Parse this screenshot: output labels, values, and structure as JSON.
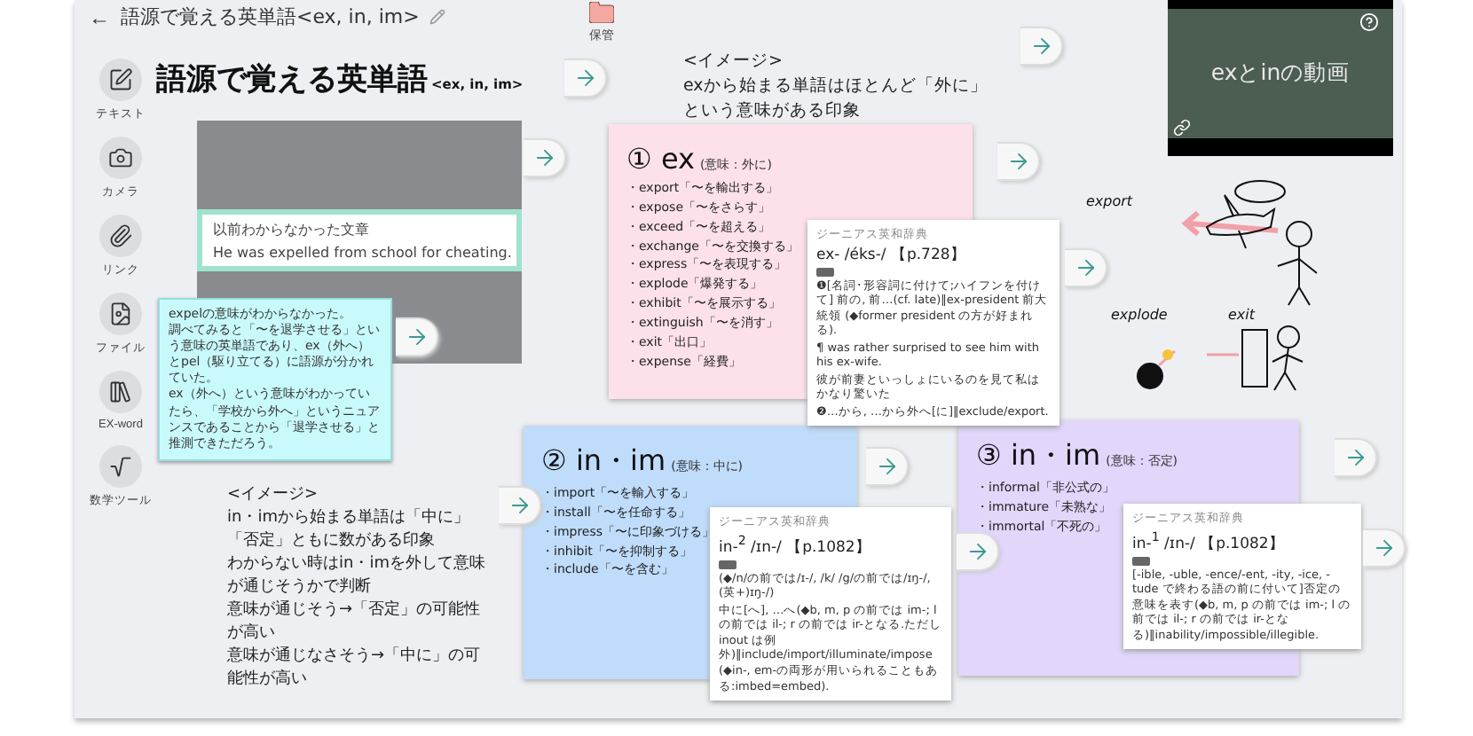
{
  "header": {
    "back": "←",
    "title": "語源で覚える英単語<ex, in, im>"
  },
  "storage": {
    "label": "保管"
  },
  "tools": [
    {
      "label": "テキスト",
      "kind": "text"
    },
    {
      "label": "カメラ",
      "kind": "camera"
    },
    {
      "label": "リンク",
      "kind": "link"
    },
    {
      "label": "ファイル",
      "kind": "file"
    },
    {
      "label": "EX-word",
      "kind": "book"
    },
    {
      "label": "数学ツール",
      "kind": "math"
    }
  ],
  "board": {
    "title": "語源で覚える英単語",
    "subtitle": "<ex, in, im>"
  },
  "photo_card": {
    "caption": "以前わからなかった文章",
    "sentence": "He was expelled from school for cheating."
  },
  "note": {
    "lines": [
      "expelの意味がわからなかった。",
      "調べてみると「〜を退学させる」という意味の英単語であり、ex（外へ）とpel（駆り立てる）に語源が分かれていた。",
      "ex（外へ）という意味がわかっていたら、「学校から外へ」というニュアンスであることから「退学させる」と推測できただろう。"
    ]
  },
  "image_notes": [
    {
      "lines": [
        "<イメージ>",
        "exから始まる単語はほとんど「外に」という意味がある印象"
      ]
    },
    {
      "lines": [
        "<イメージ>",
        "in・imから始まる単語は「中に」「否定」ともに数がある印象",
        "わからない時はin・imを外して意味が通じそうかで判断",
        "意味が通じそう→「否定」の可能性が高い",
        "意味が通じなさそう→「中に」の可能性が高い"
      ]
    }
  ],
  "word_cards": [
    {
      "number": "①",
      "prefix": "ex",
      "meaning": "(意味：外に)",
      "color": "#fde1ea",
      "items": [
        {
          "word": "・export",
          "gloss": "「〜を輸出する」"
        },
        {
          "word": "・expose",
          "gloss": "「〜をさらす」"
        },
        {
          "word": "・exceed",
          "gloss": "「〜を超える」"
        },
        {
          "word": "・exchange",
          "gloss": "「〜を交換する」"
        },
        {
          "word": "・express",
          "gloss": "「〜を表現する」"
        },
        {
          "word": "・explode",
          "gloss": "「爆発する」"
        },
        {
          "word": "・exhibit",
          "gloss": "「〜を展示する」"
        },
        {
          "word": "・extinguish",
          "gloss": "「〜を消す」"
        },
        {
          "word": "・exit",
          "gloss": "「出口」"
        },
        {
          "word": "・expense",
          "gloss": "「経費」"
        }
      ]
    },
    {
      "number": "②",
      "prefix": "in・im",
      "meaning": "(意味：中に)",
      "color": "#bfdcfb",
      "items": [
        {
          "word": "・import",
          "gloss": "「〜を輸入する」"
        },
        {
          "word": "・install",
          "gloss": "「〜を任命する」"
        },
        {
          "word": "・impress",
          "gloss": "「〜に印象づける」"
        },
        {
          "word": "・inhibit",
          "gloss": "「〜を抑制する」"
        },
        {
          "word": "・include",
          "gloss": "「〜を含む」"
        }
      ]
    },
    {
      "number": "③",
      "prefix": "in・im",
      "meaning": "(意味：否定)",
      "color": "#e2d6fb",
      "items": [
        {
          "word": "・informal",
          "gloss": "「非公式の」"
        },
        {
          "word": "・immature",
          "gloss": "「未熟な」"
        },
        {
          "word": "・immortal",
          "gloss": "「不死の」"
        }
      ]
    }
  ],
  "dictionary_cards": [
    {
      "source": "ジーニアス英和辞典",
      "headword": "ex-",
      "pron": "/éks-/",
      "page": "【p.728】",
      "lines": [
        "❶[名詞･形容詞に付けて;ハイフンを付けて] 前の, 前…(cf. late)‖ex-president 前大統領 (◆former president の方が好まれる).",
        "¶ was rather surprised to see him with his ex-wife.",
        "彼が前妻といっしょにいるのを見て私はかなり驚いた",
        "❷…から, …から外へ[に]‖exclude/export."
      ]
    },
    {
      "source": "ジーニアス英和辞典",
      "headword": "in-$^{2}$",
      "pron": "/ɪn-/",
      "page": "【p.1082】",
      "lines": [
        "(◆/n/の前では/ɪ-/, /k/ /g/の前では/ɪŋ-/, (英+)ɪŋ-/)",
        "中に[へ], …へ(◆b, m, p の前では im-; l の前では il-; r の前では ir-となる.ただし inout は例外)‖include/import/illuminate/impose",
        "(◆in-, em-の両形が用いられることもある:imbed=embed)."
      ]
    },
    {
      "source": "ジーニアス英和辞典",
      "headword": "in-$^{1}$",
      "pron": "/ɪn-/",
      "page": "【p.1082】",
      "lines": [
        "[-ible, -uble, -ence/-ent, -ity, -ice, -tude で終わる語の前に付いて]否定の意味を表す(◆b, m, p の前では im-; l の前では il-; r の前では ir-となる)‖inability/impossible/illegible."
      ]
    }
  ],
  "video": {
    "title": "exとinの動画"
  },
  "sketch": {
    "labels": [
      "export",
      "explode",
      "exit"
    ]
  }
}
